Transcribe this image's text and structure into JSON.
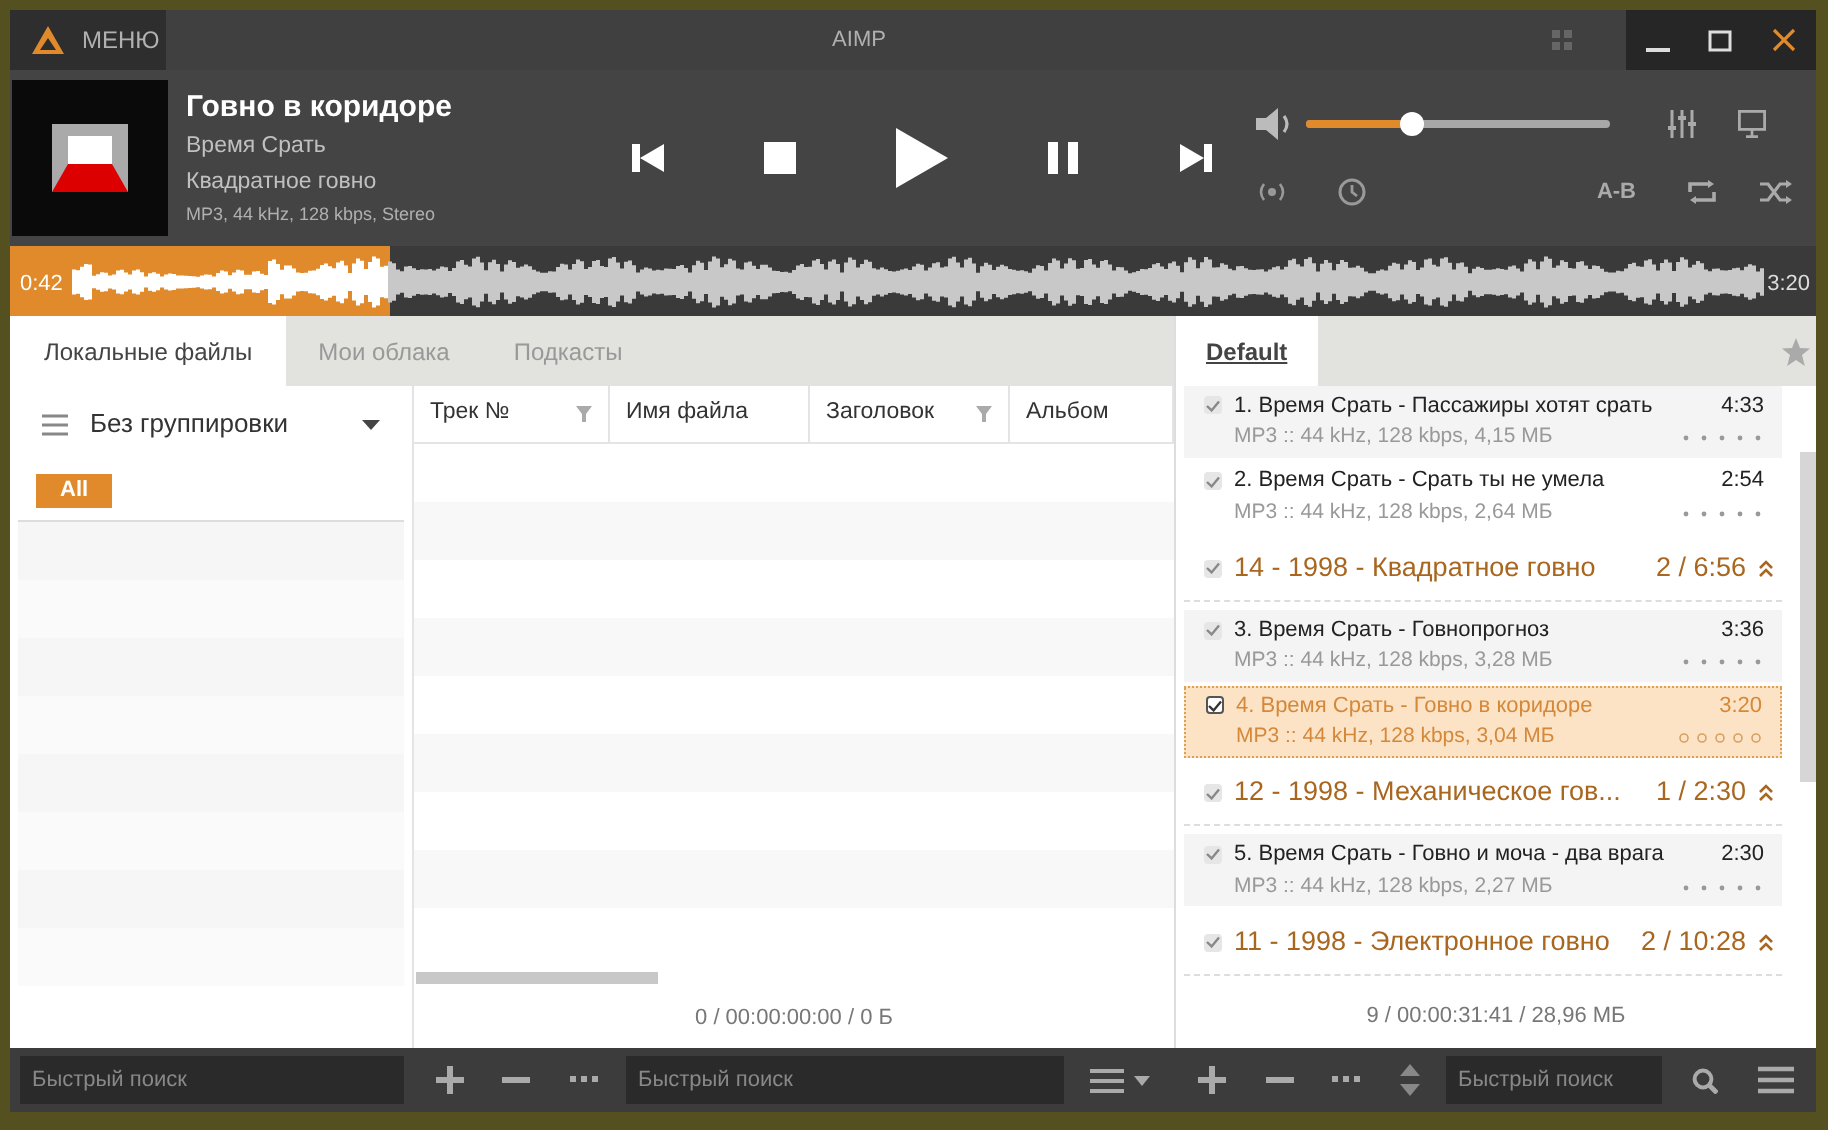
{
  "window": {
    "title": "AIMP",
    "menu_label": "МЕНЮ"
  },
  "now_playing": {
    "title": "Говно в коридоре",
    "artist": "Время Срать",
    "album": "Квадратное говно",
    "format": "MP3, 44 kHz, 128 kbps, Stereo"
  },
  "volume": {
    "level": 0.35
  },
  "second_row": {
    "ab_label": "A-B"
  },
  "waveform": {
    "level": 0.21,
    "elapsed": "0:42",
    "total": "3:20"
  },
  "library": {
    "tabs": [
      {
        "label": "Локальные файлы",
        "selected": true
      },
      {
        "label": "Мои облака",
        "selected": false
      },
      {
        "label": "Подкасты",
        "selected": false
      }
    ],
    "grouping": "Без группировки",
    "filter_chip": "All",
    "columns": [
      {
        "label": "Трек №",
        "filter": true
      },
      {
        "label": "Имя файла",
        "filter": false
      },
      {
        "label": "Заголовок",
        "filter": true
      },
      {
        "label": "Альбом",
        "filter": false
      }
    ],
    "status": "0 / 00:00:00:00 / 0 Б",
    "search_placeholder": "Быстрый поиск",
    "table_search_placeholder": "Быстрый поиск"
  },
  "playlist": {
    "tab": "Default",
    "status": "9 / 00:00:31:41 / 28,96 МБ",
    "search_placeholder": "Быстрый поиск",
    "entries": [
      {
        "kind": "track",
        "checked": true,
        "selected": false,
        "title": "1. Время Срать - Пассажиры хотят срать",
        "duration": "4:33",
        "info": "MP3 :: 44 kHz, 128 kbps, 4,15 МБ"
      },
      {
        "kind": "track",
        "checked": true,
        "selected": false,
        "title": "2. Время Срать - Срать ты не умела",
        "duration": "2:54",
        "info": "MP3 :: 44 kHz, 128 kbps, 2,64 МБ"
      },
      {
        "kind": "group",
        "checked": true,
        "title": "14 - 1998 - Квадратное говно",
        "summary": "2 / 6:56"
      },
      {
        "kind": "track",
        "checked": true,
        "selected": false,
        "title": "3. Время Срать - Говнопрогноз",
        "duration": "3:36",
        "info": "MP3 :: 44 kHz, 128 kbps, 3,28 МБ"
      },
      {
        "kind": "track",
        "checked": true,
        "selected": true,
        "title": "4. Время Срать - Говно в коридоре",
        "duration": "3:20",
        "info": "MP3 :: 44 kHz, 128 kbps, 3,04 МБ"
      },
      {
        "kind": "group",
        "checked": true,
        "title": "12 - 1998 - Механическое гов...",
        "summary": "1 / 2:30"
      },
      {
        "kind": "track",
        "checked": true,
        "selected": false,
        "title": "5. Время Срать - Говно и моча - два врага",
        "duration": "2:30",
        "info": "MP3 :: 44 kHz, 128 kbps, 2,27 МБ"
      },
      {
        "kind": "group",
        "checked": true,
        "title": "11 - 1998 - Электронное говно",
        "summary": "2 / 10:28"
      }
    ]
  }
}
